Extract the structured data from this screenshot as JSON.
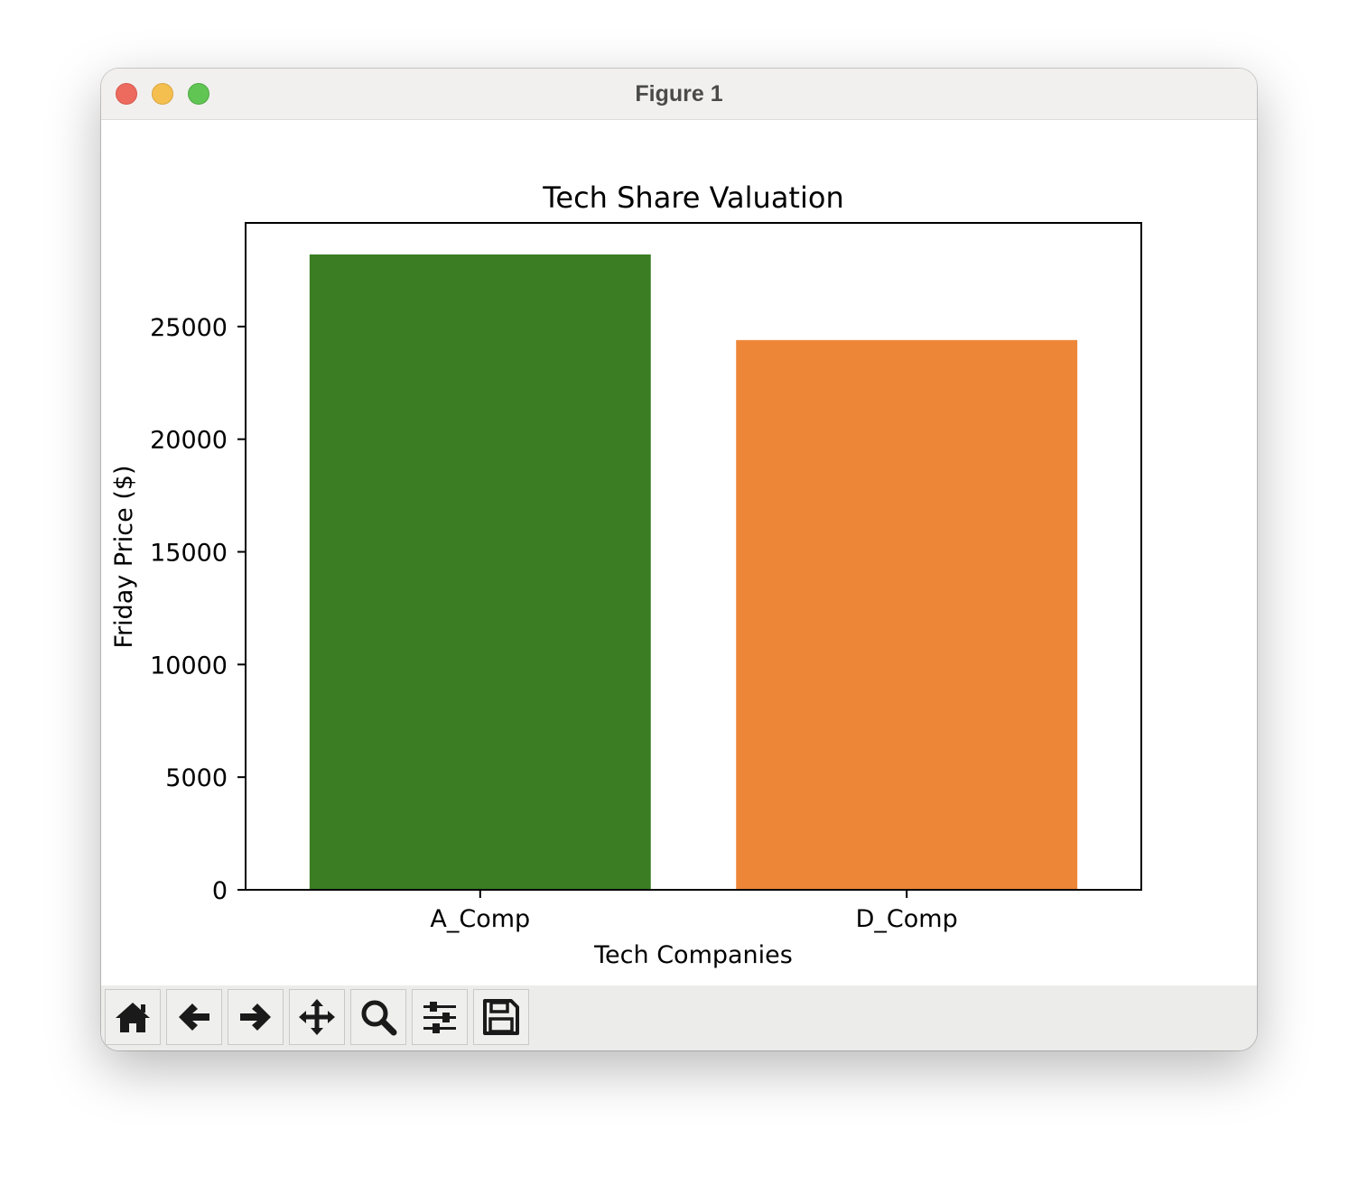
{
  "window": {
    "title": "Figure 1"
  },
  "toolbar": {
    "buttons": [
      {
        "name": "home",
        "icon": "home-icon"
      },
      {
        "name": "back",
        "icon": "arrow-left-icon"
      },
      {
        "name": "forward",
        "icon": "arrow-right-icon"
      },
      {
        "name": "pan",
        "icon": "move-icon"
      },
      {
        "name": "zoom",
        "icon": "search-icon"
      },
      {
        "name": "configure",
        "icon": "sliders-icon"
      },
      {
        "name": "save",
        "icon": "floppy-disk-icon"
      }
    ]
  },
  "chart_data": {
    "type": "bar",
    "title": "Tech Share Valuation",
    "xlabel": "Tech Companies",
    "ylabel": "Friday Price ($)",
    "categories": [
      "A_Comp",
      "D_Comp"
    ],
    "values": [
      28200,
      24400
    ],
    "colors": [
      "#3a7d22",
      "#ee8638"
    ],
    "ylim": [
      0,
      29600
    ],
    "yticks": [
      0,
      5000,
      10000,
      15000,
      20000,
      25000
    ],
    "grid": false
  }
}
